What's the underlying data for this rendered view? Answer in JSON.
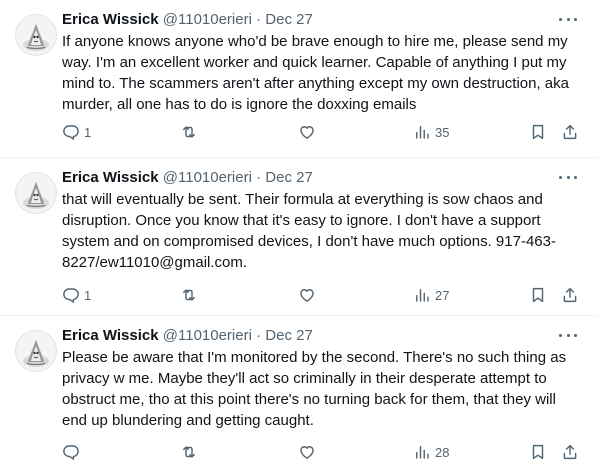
{
  "tweets": [
    {
      "author_name": "Erica Wissick",
      "handle": "@11010erieri",
      "separator": "·",
      "date": "Dec 27",
      "text": "If anyone knows anyone who'd be brave enough to hire me, please send my way. I'm an excellent worker and quick learner. Capable of anything I put my mind to. The scammers aren't after anything except my own destruction, aka murder, all one has to do is ignore the doxxing emails",
      "reply_count": "1",
      "views_count": "35"
    },
    {
      "author_name": "Erica Wissick",
      "handle": "@11010erieri",
      "separator": "·",
      "date": "Dec 27",
      "text": "that will eventually be sent. Their formula at everything is sow chaos and disruption. Once you know that it's easy to ignore. I don't have a support system and on compromised devices, I don't have much options. 917-463-8227/ew11010@gmail.com.",
      "reply_count": "1",
      "views_count": "27"
    },
    {
      "author_name": "Erica Wissick",
      "handle": "@11010erieri",
      "separator": "·",
      "date": "Dec 27",
      "text": "Please be aware that I'm monitored by the second. There's no such thing as privacy w me. Maybe they'll act so criminally in their desperate attempt to obstruct me, tho at this point there's no turning back for them, that they will end up blundering and getting caught.",
      "reply_count": "",
      "views_count": "28"
    }
  ],
  "icons": {
    "more": "more-icon",
    "reply": "reply-icon",
    "retweet": "retweet-icon",
    "like": "like-icon",
    "views": "views-icon",
    "bookmark": "bookmark-icon",
    "share": "share-icon"
  },
  "colors": {
    "text": "#0f1419",
    "secondary": "#536471",
    "divider": "#eff3f4",
    "background": "#ffffff"
  }
}
